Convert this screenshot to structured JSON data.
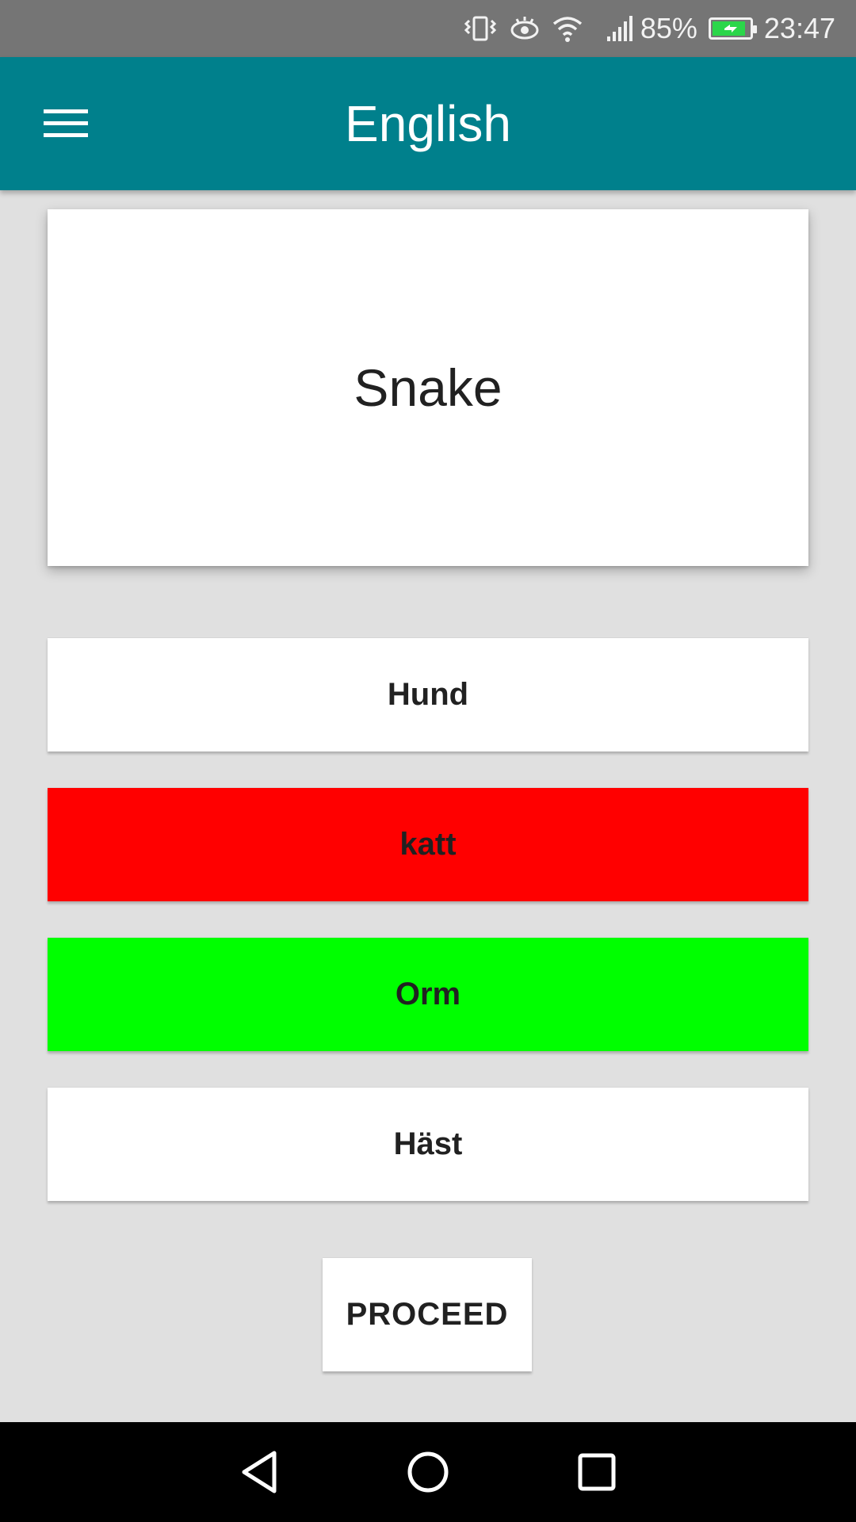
{
  "status_bar": {
    "battery_percent": "85%",
    "time": "23:47",
    "battery_level": 0.85,
    "battery_charging_color": "#2bd64a",
    "icons": [
      "vibrate-icon",
      "eye-icon",
      "wifi-icon",
      "signal-icon",
      "battery-icon"
    ]
  },
  "app_bar": {
    "title": "English",
    "background": "#00808c",
    "menu_icon": "hamburger-menu-icon"
  },
  "question": {
    "word": "Snake"
  },
  "options": [
    {
      "label": "Hund",
      "state": "neutral",
      "color": "#ffffff"
    },
    {
      "label": "katt",
      "state": "wrong",
      "color": "#ff0000"
    },
    {
      "label": "Orm",
      "state": "correct",
      "color": "#00ff00"
    },
    {
      "label": "Häst",
      "state": "neutral",
      "color": "#ffffff"
    }
  ],
  "proceed": {
    "label": "PROCEED"
  },
  "nav_bar": {
    "icons": [
      "back-triangle-icon",
      "home-circle-icon",
      "recents-square-icon"
    ]
  }
}
